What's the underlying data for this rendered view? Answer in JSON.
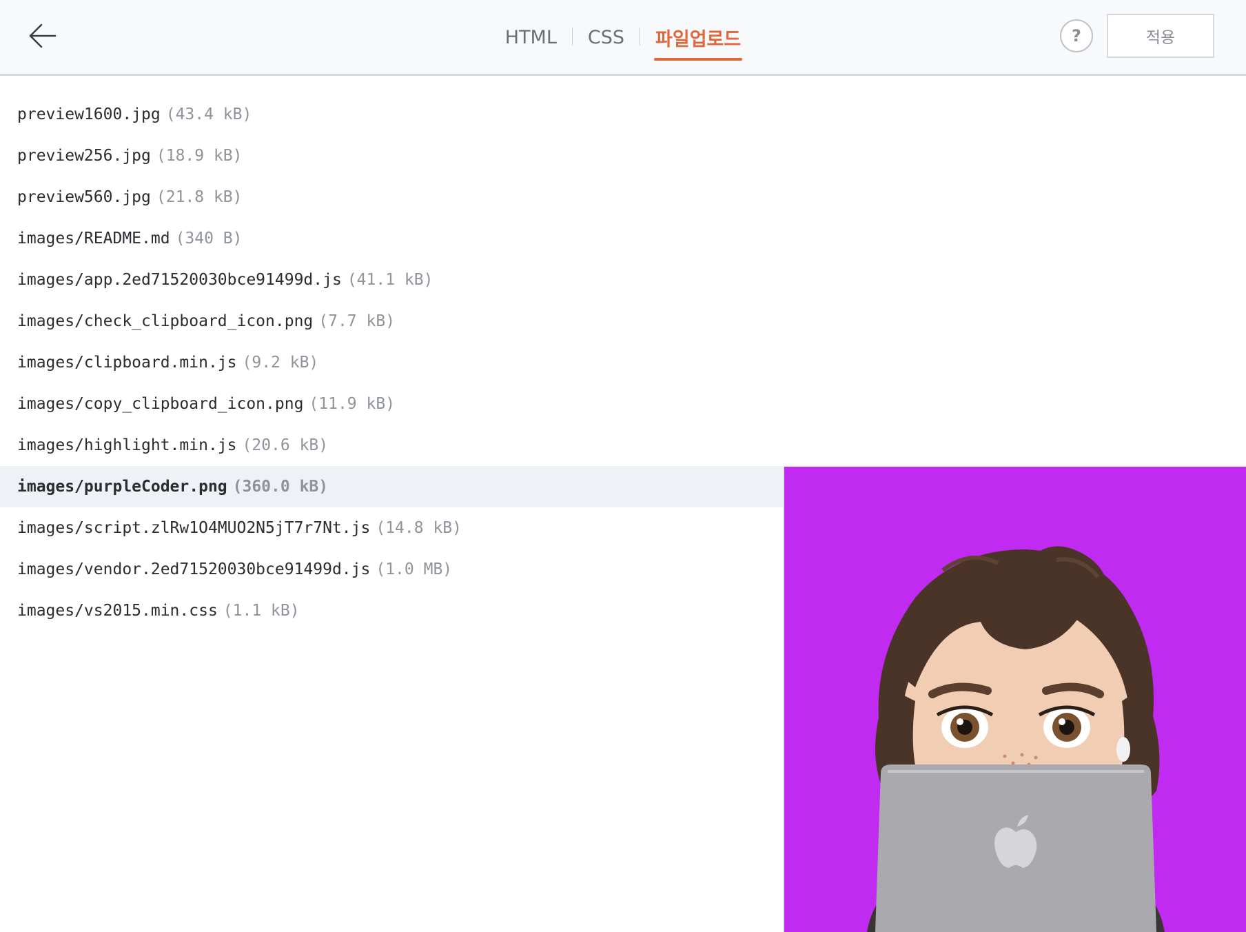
{
  "tabs": [
    {
      "label": "HTML",
      "active": false
    },
    {
      "label": "CSS",
      "active": false
    },
    {
      "label": "파일업로드",
      "active": true
    }
  ],
  "help_label": "?",
  "apply_label": "적용",
  "files": [
    {
      "name": "preview1600.jpg",
      "size": "(43.4 kB)"
    },
    {
      "name": "preview256.jpg",
      "size": "(18.9 kB)"
    },
    {
      "name": "preview560.jpg",
      "size": "(21.8 kB)"
    },
    {
      "name": "images/README.md",
      "size": "(340 B)"
    },
    {
      "name": "images/app.2ed71520030bce91499d.js",
      "size": "(41.1 kB)"
    },
    {
      "name": "images/check_clipboard_icon.png",
      "size": "(7.7 kB)"
    },
    {
      "name": "images/clipboard.min.js",
      "size": "(9.2 kB)"
    },
    {
      "name": "images/copy_clipboard_icon.png",
      "size": "(11.9 kB)"
    },
    {
      "name": "images/highlight.min.js",
      "size": "(20.6 kB)"
    },
    {
      "name": "images/purpleCoder.png",
      "size": "(360.0 kB)"
    },
    {
      "name": "images/script.zlRw1O4MUO2N5jT7r7Nt.js",
      "size": "(14.8 kB)"
    },
    {
      "name": "images/vendor.2ed71520030bce91499d.js",
      "size": "(1.0 MB)"
    },
    {
      "name": "images/vs2015.min.css",
      "size": "(1.1 kB)"
    }
  ],
  "selected_index": 9,
  "colors": {
    "accent": "#e0663b",
    "preview_background": "#c12af0"
  }
}
